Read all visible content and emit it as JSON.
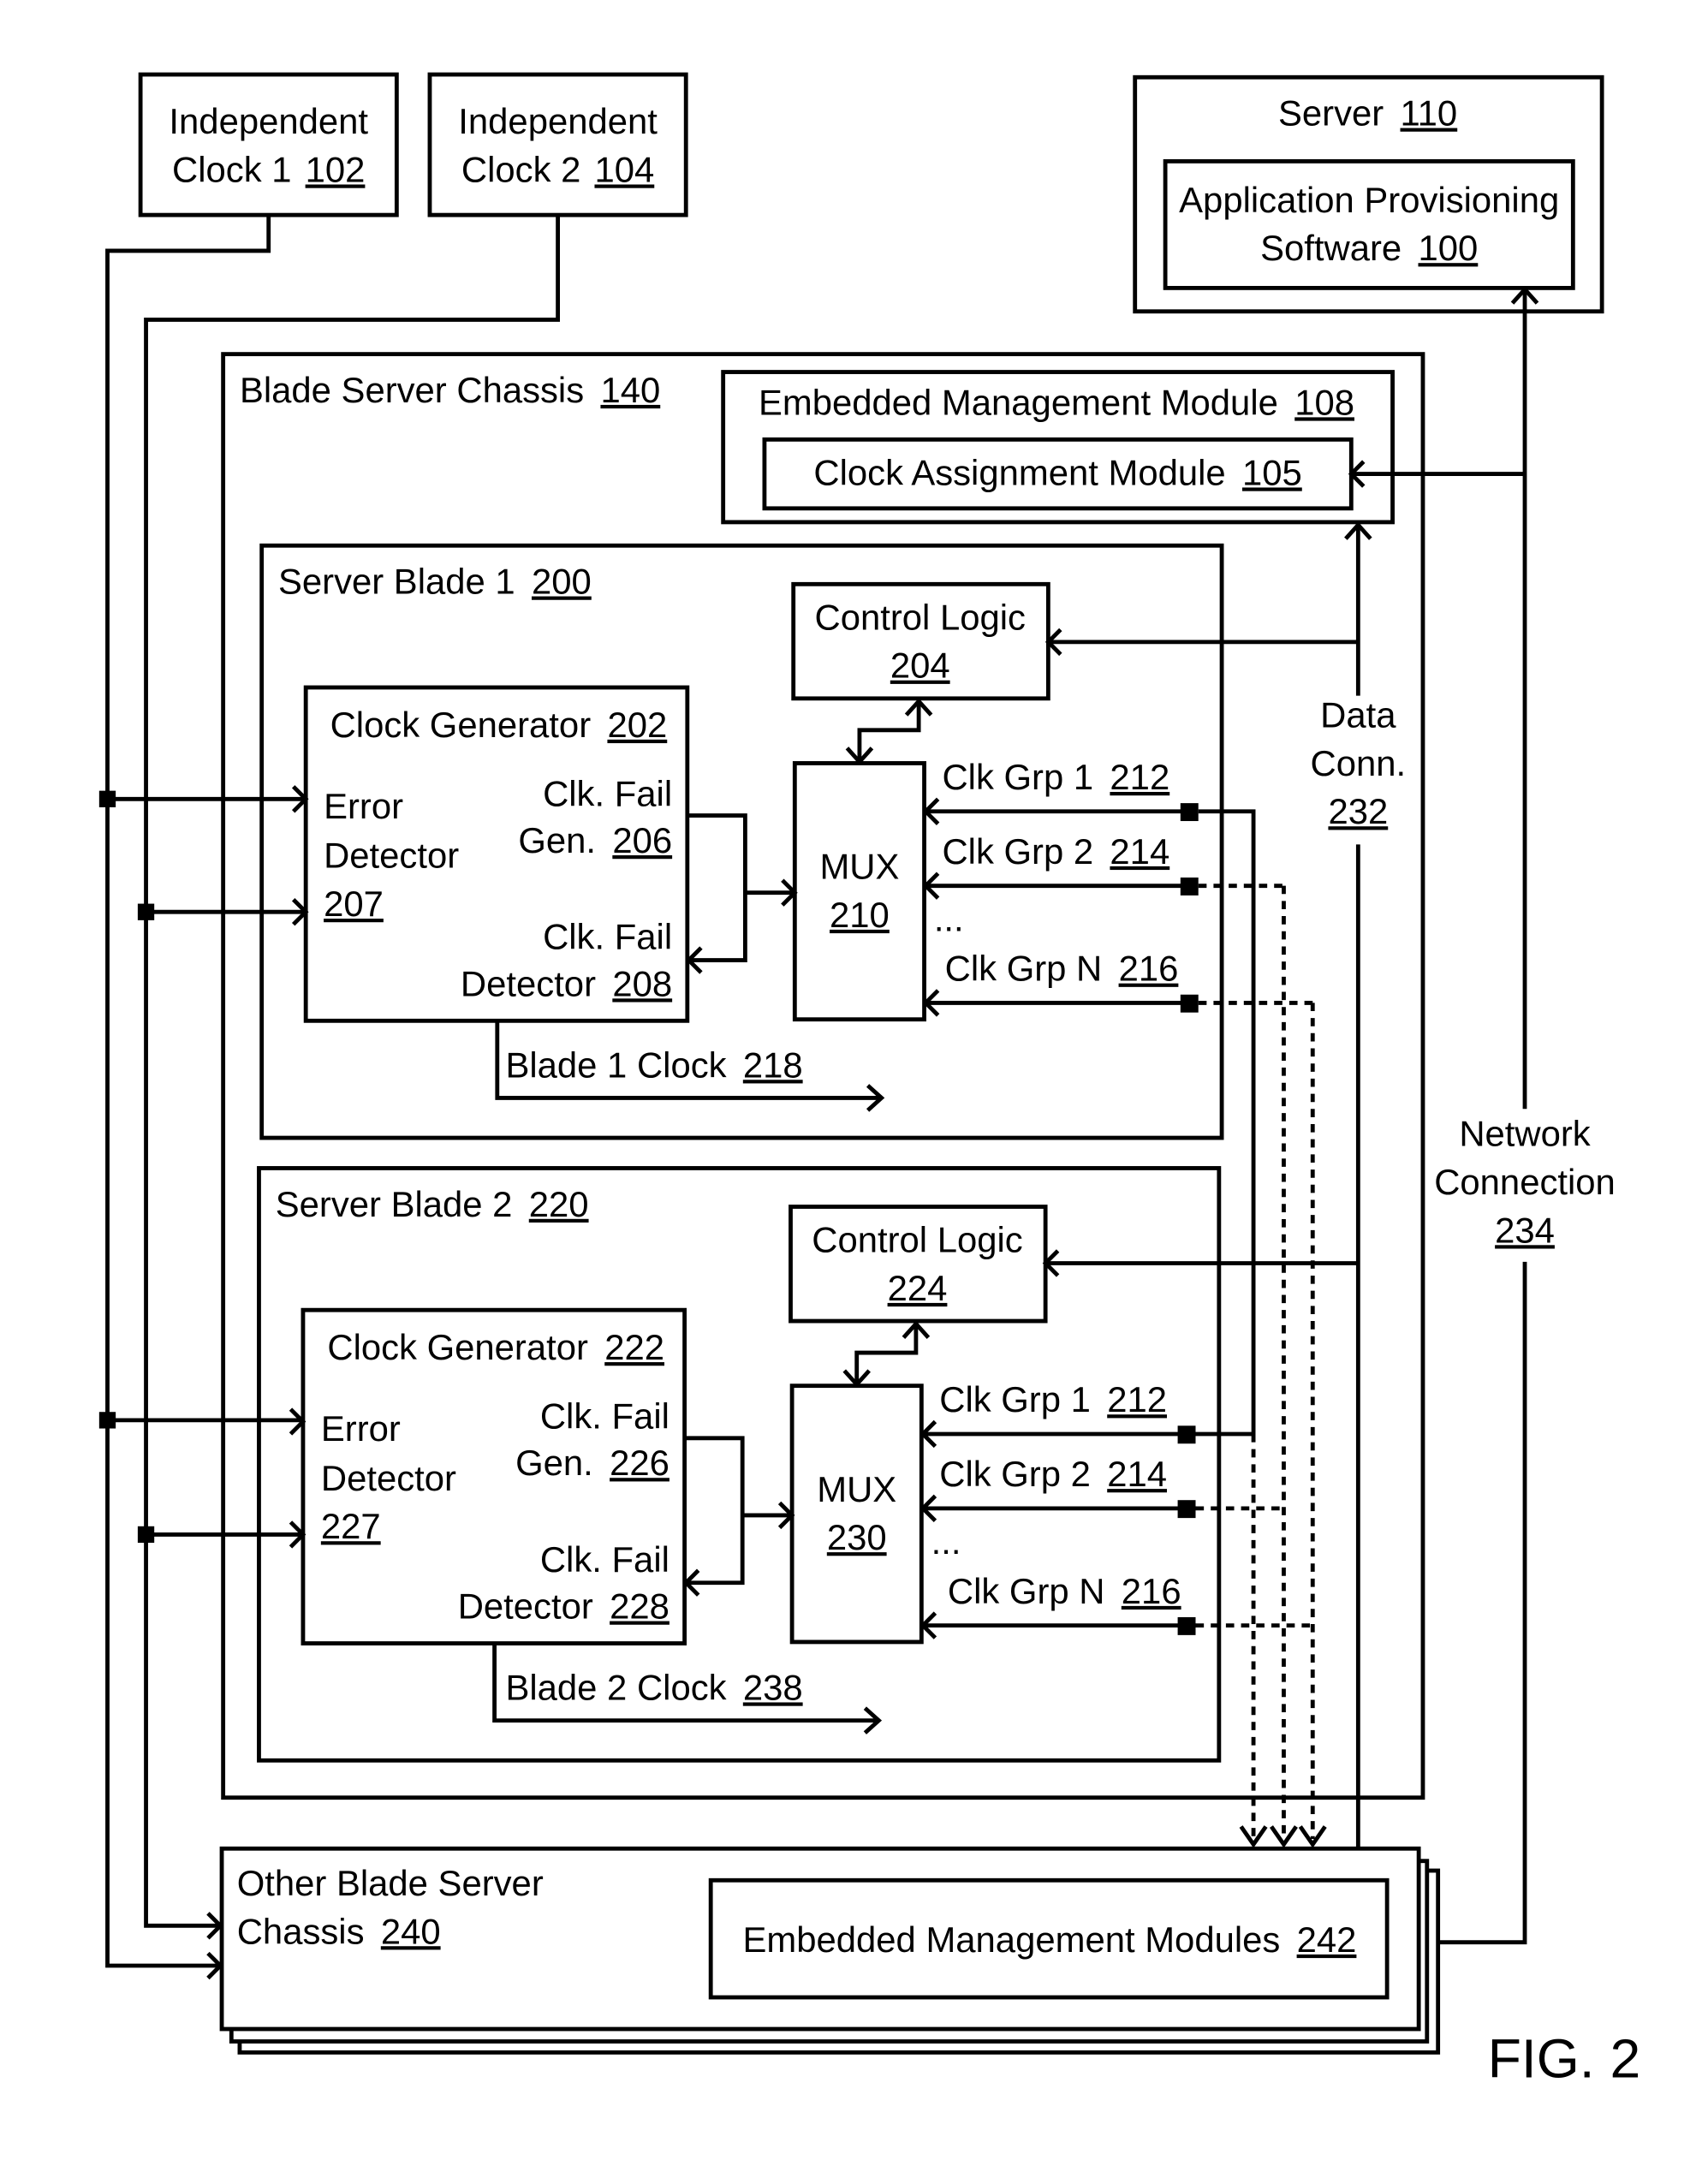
{
  "figure_label": "FIG. 2",
  "independent_clock_1": {
    "line1": "Independent",
    "line2": "Clock 1",
    "ref": "102"
  },
  "independent_clock_2": {
    "line1": "Independent",
    "line2": "Clock 2",
    "ref": "104"
  },
  "server": {
    "label": "Server",
    "ref": "110",
    "software": {
      "line1": "Application Provisioning",
      "line2": "Software",
      "ref": "100"
    }
  },
  "chassis": {
    "label": "Blade Server Chassis",
    "ref": "140",
    "emm": {
      "label": "Embedded Management Module",
      "ref": "108"
    },
    "cam": {
      "label": "Clock Assignment Module",
      "ref": "105"
    }
  },
  "blades": [
    {
      "label": "Server Blade 1",
      "ref": "200",
      "control_logic": {
        "label": "Control Logic",
        "ref": "204"
      },
      "clock_generator": {
        "label": "Clock Generator",
        "ref": "202"
      },
      "error_detector": {
        "line1": "Error",
        "line2": "Detector",
        "ref": "207"
      },
      "fail_gen": {
        "line1": "Clk. Fail",
        "line2": "Gen.",
        "ref": "206"
      },
      "fail_det": {
        "line1": "Clk. Fail",
        "line2": "Detector",
        "ref": "208"
      },
      "mux": {
        "label": "MUX",
        "ref": "210"
      },
      "blade_clock": {
        "label": "Blade 1 Clock",
        "ref": "218"
      }
    },
    {
      "label": "Server Blade 2",
      "ref": "220",
      "control_logic": {
        "label": "Control Logic",
        "ref": "224"
      },
      "clock_generator": {
        "label": "Clock Generator",
        "ref": "222"
      },
      "error_detector": {
        "line1": "Error",
        "line2": "Detector",
        "ref": "227"
      },
      "fail_gen": {
        "line1": "Clk. Fail",
        "line2": "Gen.",
        "ref": "226"
      },
      "fail_det": {
        "line1": "Clk. Fail",
        "line2": "Detector",
        "ref": "228"
      },
      "mux": {
        "label": "MUX",
        "ref": "230"
      },
      "blade_clock": {
        "label": "Blade 2 Clock",
        "ref": "238"
      }
    }
  ],
  "clock_groups": [
    {
      "label": "Clk Grp 1",
      "ref": "212"
    },
    {
      "label": "Clk Grp 2",
      "ref": "214"
    },
    {
      "label": "Clk Grp N",
      "ref": "216"
    }
  ],
  "ellipsis": "...",
  "data_conn": {
    "line1": "Data",
    "line2": "Conn.",
    "ref": "232"
  },
  "network_conn": {
    "line1": "Network",
    "line2": "Connection",
    "ref": "234"
  },
  "other_chassis": {
    "line1": "Other Blade Server",
    "line2": "Chassis",
    "ref": "240",
    "emms": {
      "label": "Embedded Management Modules",
      "ref": "242"
    }
  }
}
